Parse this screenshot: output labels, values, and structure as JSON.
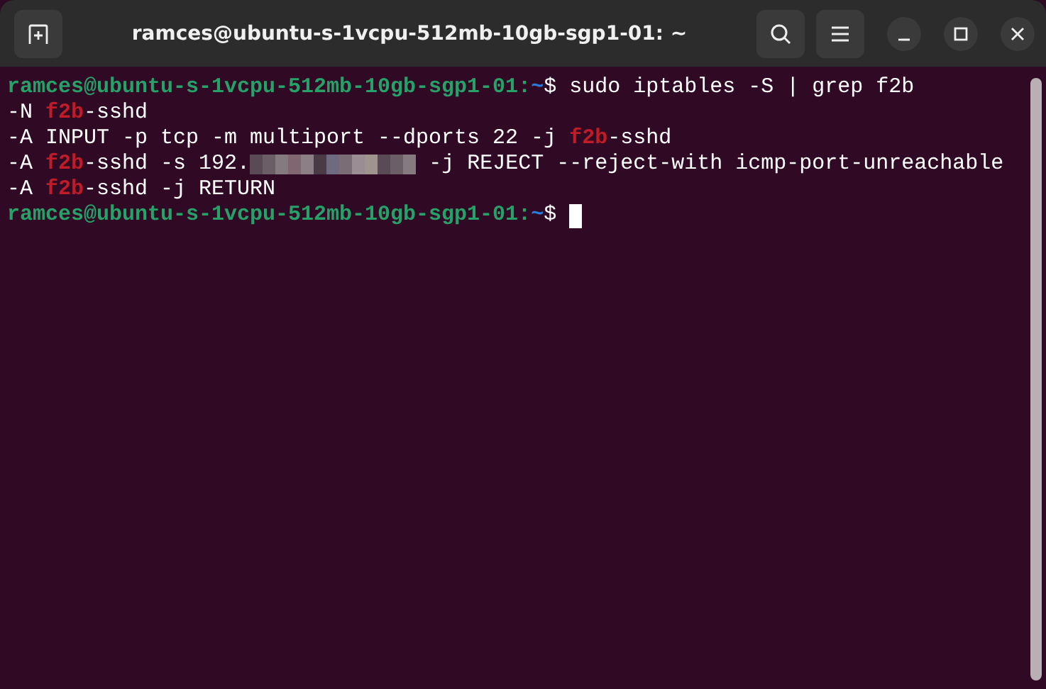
{
  "window": {
    "title": "ramces@ubuntu-s-1vcpu-512mb-10gb-sgp1-01: ~"
  },
  "terminal": {
    "lines": [
      {
        "cursor": false,
        "segments": [
          {
            "kind": "user",
            "text": "ramces@ubuntu-s-1vcpu-512mb-10gb-sgp1-01:"
          },
          {
            "kind": "path",
            "text": "~"
          },
          {
            "kind": "plain",
            "text": "$ sudo iptables -S | grep f2b"
          }
        ]
      },
      {
        "cursor": false,
        "segments": [
          {
            "kind": "plain",
            "text": "-N "
          },
          {
            "kind": "match",
            "text": "f2b"
          },
          {
            "kind": "plain",
            "text": "-sshd"
          }
        ]
      },
      {
        "cursor": false,
        "segments": [
          {
            "kind": "plain",
            "text": "-A INPUT -p tcp -m multiport --dports 22 -j "
          },
          {
            "kind": "match",
            "text": "f2b"
          },
          {
            "kind": "plain",
            "text": "-sshd"
          }
        ]
      },
      {
        "cursor": false,
        "segments": [
          {
            "kind": "plain",
            "text": "-A "
          },
          {
            "kind": "match",
            "text": "f2b"
          },
          {
            "kind": "plain",
            "text": "-sshd -s 192."
          },
          {
            "kind": "redacted"
          },
          {
            "kind": "plain",
            "text": " -j REJECT --reject-with icmp-port-unreachable"
          }
        ]
      },
      {
        "cursor": false,
        "segments": [
          {
            "kind": "plain",
            "text": "-A "
          },
          {
            "kind": "match",
            "text": "f2b"
          },
          {
            "kind": "plain",
            "text": "-sshd -j RETURN"
          }
        ]
      },
      {
        "cursor": true,
        "segments": [
          {
            "kind": "user",
            "text": "ramces@ubuntu-s-1vcpu-512mb-10gb-sgp1-01:"
          },
          {
            "kind": "path",
            "text": "~"
          },
          {
            "kind": "plain",
            "text": "$ "
          }
        ]
      }
    ]
  }
}
